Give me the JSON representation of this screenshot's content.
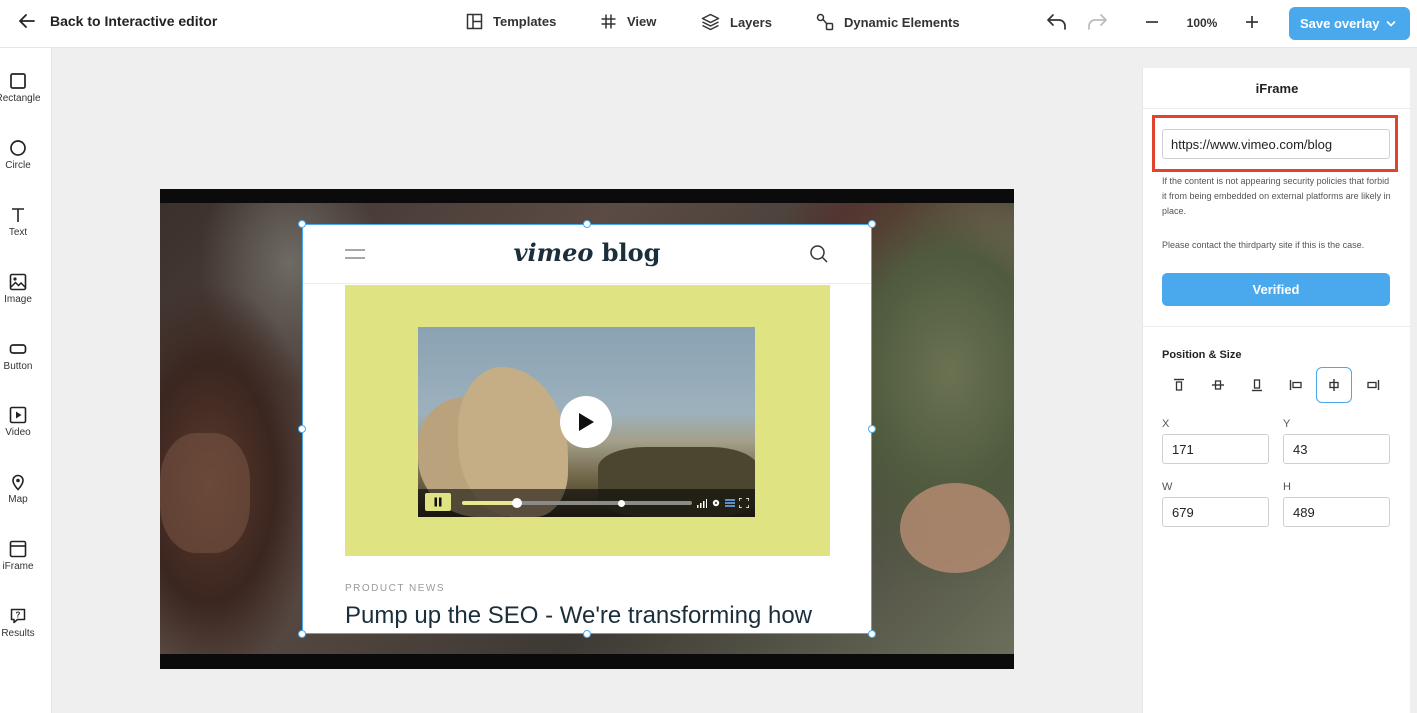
{
  "topbar": {
    "back_label": "Back to Interactive editor",
    "nav": [
      {
        "label": "Templates",
        "icon": "templates-icon"
      },
      {
        "label": "View",
        "icon": "grid-hash-icon"
      },
      {
        "label": "Layers",
        "icon": "layers-icon"
      },
      {
        "label": "Dynamic Elements",
        "icon": "dynamic-elements-icon"
      }
    ],
    "zoom": "100%",
    "save_label": "Save overlay",
    "accent": "#4aa9ec"
  },
  "tools": [
    {
      "label": "Rectangle",
      "icon": "rectangle-icon"
    },
    {
      "label": "Circle",
      "icon": "circle-icon"
    },
    {
      "label": "Text",
      "icon": "text-icon"
    },
    {
      "label": "Image",
      "icon": "image-icon"
    },
    {
      "label": "Button",
      "icon": "button-icon"
    },
    {
      "label": "Video",
      "icon": "video-icon"
    },
    {
      "label": "Map",
      "icon": "map-pin-icon"
    },
    {
      "label": "iFrame",
      "icon": "iframe-icon"
    },
    {
      "label": "Results",
      "icon": "results-icon"
    }
  ],
  "iframe_content": {
    "logo_italic": "vimeo",
    "logo_rest": " blog",
    "eyebrow": "PRODUCT NEWS",
    "headline": "Pump up the SEO - We're transforming how",
    "hero_color": "#dfe382",
    "playback_progress": 0.24
  },
  "panel": {
    "title": "iFrame",
    "url_value": "https://www.vimeo.com/blog",
    "help_text_1": "If the content is not appearing security policies that forbid it from being embedded on external platforms are likely in place.",
    "help_text_2": "Please contact the thirdparty site if this is the case.",
    "verified_label": "Verified",
    "position_size_label": "Position & Size",
    "x_label": "X",
    "x_value": "171",
    "y_label": "Y",
    "y_value": "43",
    "w_label": "W",
    "w_value": "679",
    "h_label": "H",
    "h_value": "489",
    "highlight_color": "#e0432e"
  }
}
